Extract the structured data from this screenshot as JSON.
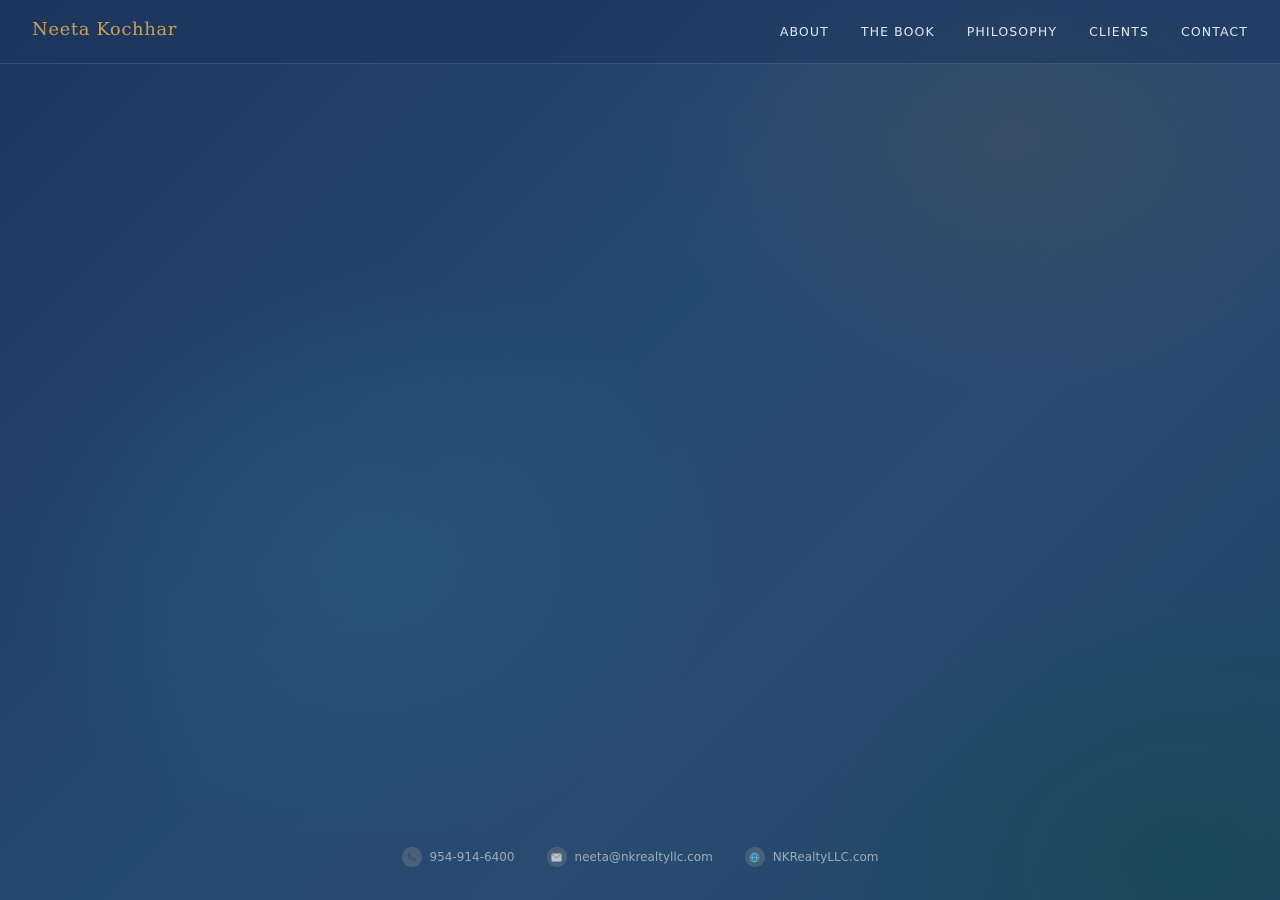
{
  "brand": {
    "name": "Neeta Kochhar"
  },
  "nav": {
    "items": [
      "ABOUT",
      "THE BOOK",
      "PHILOSOPHY",
      "CLIENTS",
      "CONTACT"
    ]
  },
  "contact": {
    "items": [
      {
        "icon": "phone-icon",
        "text": "954-914-6400"
      },
      {
        "icon": "email-icon",
        "text": "neeta@nkrealtyllc.com"
      },
      {
        "icon": "globe-icon",
        "text": "NKRealtyLLC.com"
      }
    ]
  },
  "colors": {
    "brand_gold": "#c6a15a",
    "nav_text": "#dfe5ee",
    "background_navy": "#22416a",
    "contact_text": "#98aabd"
  }
}
